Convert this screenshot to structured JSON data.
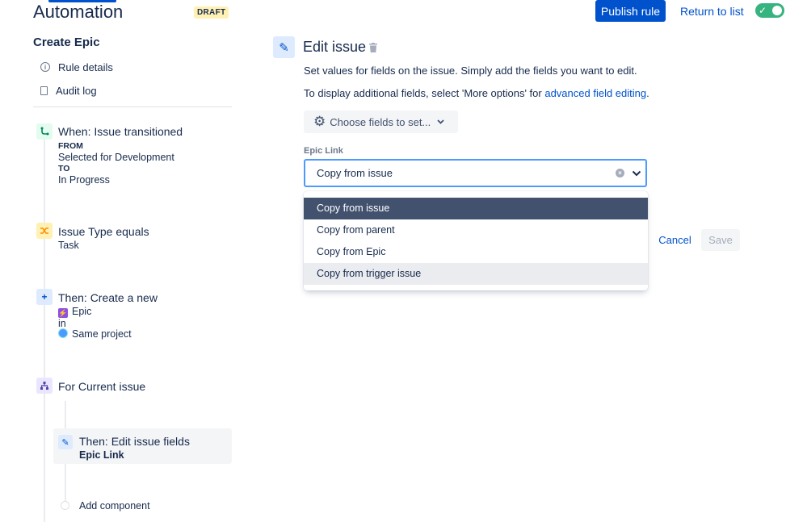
{
  "header": {
    "app_title": "Automation",
    "status_badge": "DRAFT",
    "publish_label": "Publish rule",
    "return_label": "Return to list",
    "rule_enabled": true
  },
  "sidebar": {
    "rule_name": "Create Epic",
    "links": [
      {
        "label": "Rule details",
        "icon": "info-icon"
      },
      {
        "label": "Audit log",
        "icon": "document-icon"
      }
    ],
    "steps": {
      "trigger": {
        "title": "When: Issue transitioned",
        "from_label": "FROM",
        "from_value": "Selected for Development",
        "to_label": "TO",
        "to_value": "In Progress"
      },
      "condition": {
        "title": "Issue Type equals",
        "value": "Task"
      },
      "action_create": {
        "title": "Then: Create a new",
        "issue_type": "Epic",
        "in_label": "in",
        "project": "Same project"
      },
      "branch": {
        "title": "For Current issue"
      },
      "selected_action": {
        "title": "Then: Edit issue fields",
        "subtitle": "Epic Link"
      },
      "add_component": "Add component"
    }
  },
  "main": {
    "title": "Edit issue",
    "description_1": "Set values for fields on the issue. Simply add the fields you want to edit.",
    "description_2_prefix": "To display additional fields, select 'More options' for ",
    "description_2_link": "advanced field editing",
    "description_2_suffix": ".",
    "choose_fields_label": "Choose fields to set...",
    "field_label": "Epic Link",
    "field_value": "Copy from issue",
    "options": [
      "Copy from issue",
      "Copy from parent",
      "Copy from Epic",
      "Copy from trigger issue"
    ],
    "cancel_label": "Cancel",
    "save_label": "Save"
  },
  "colors": {
    "primary": "#0052cc",
    "focus_border": "#4c9aff",
    "toggle_on": "#36b37e",
    "draft_badge_bg": "#fff0b3",
    "selected_option_bg": "#42526e"
  }
}
